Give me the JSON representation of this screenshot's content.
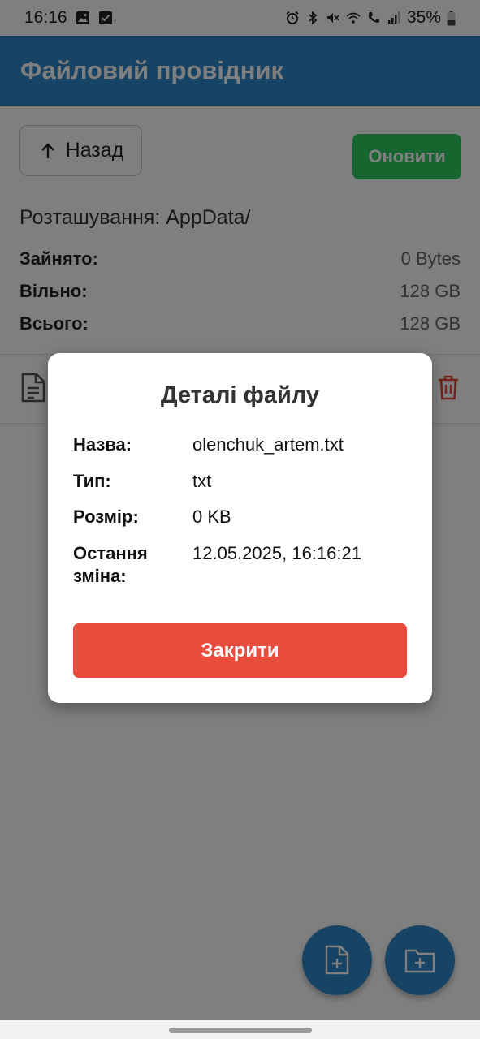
{
  "status_bar": {
    "time": "16:16",
    "battery": "35%"
  },
  "header": {
    "title": "Файловий провідник"
  },
  "toolbar": {
    "back_label": "Назад",
    "refresh_label": "Оновити"
  },
  "location": "Розташування: AppData/",
  "storage": {
    "used_label": "Зайнято:",
    "used_value": "0 Bytes",
    "free_label": "Вільно:",
    "free_value": "128 GB",
    "total_label": "Всього:",
    "total_value": "128 GB"
  },
  "dialog": {
    "title": "Деталі файлу",
    "name_label": "Назва:",
    "name_value": "olenchuk_artem.txt",
    "type_label": "Тип:",
    "type_value": "txt",
    "size_label": "Розмір:",
    "size_value": "0 KB",
    "modified_label": "Остання зміна:",
    "modified_value": "12.05.2025, 16:16:21",
    "close_label": "Закрити"
  },
  "colors": {
    "header": "#2f86c9",
    "refresh": "#2ecc5e",
    "close": "#e74c3c",
    "delete": "#e74c3c"
  },
  "icons": [
    "image-icon",
    "checkbox-icon",
    "alarm-icon",
    "bluetooth-icon",
    "mute-icon",
    "wifi-icon",
    "call-icon",
    "signal-icon",
    "battery-icon",
    "arrow-up-icon",
    "file-icon",
    "trash-icon",
    "new-file-icon",
    "new-folder-icon"
  ]
}
